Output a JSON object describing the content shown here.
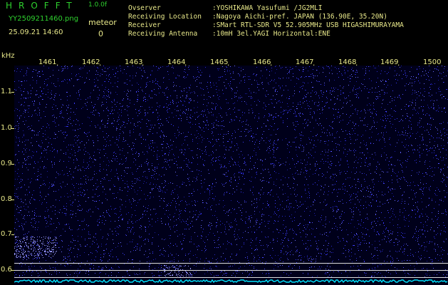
{
  "header": {
    "title": "HROFFT",
    "version": "1.0.0f",
    "filename": "YY2509211460.png",
    "datetime": "25.09.21 14:60",
    "meteor_label": "meteor",
    "meteor_count": "0"
  },
  "info": [
    {
      "key": "Ovserver",
      "value": ":YOSHIKAWA Yasufumi /JG2MLI"
    },
    {
      "key": "Receiving Location",
      "value": ":Nagoya Aichi-pref. JAPAN (136.90E, 35.20N)"
    },
    {
      "key": "Receiver",
      "value": ":SMart RTL-SDR V5 52.905MHz USB HIGASHIMURAYAMA"
    },
    {
      "key": "Receiving Antenna",
      "value": ":10mH 3el.YAGI Horizontal:ENE"
    }
  ],
  "y_axis_unit": "kHz",
  "time_ticks": [
    "1461",
    "1462",
    "1463",
    "1464",
    "1465",
    "1466",
    "1467",
    "1468",
    "1469",
    "1500"
  ],
  "freq_ticks": [
    "1.1",
    "1.0",
    "0.9",
    "0.8",
    "0.7",
    "0.6"
  ],
  "colors": {
    "background": "#000000",
    "header_green": "#2ed12e",
    "text_yellow": "#e8e88a",
    "waterfall_dot": "#3a3aff",
    "noise_floor": "#00e5ff"
  }
}
